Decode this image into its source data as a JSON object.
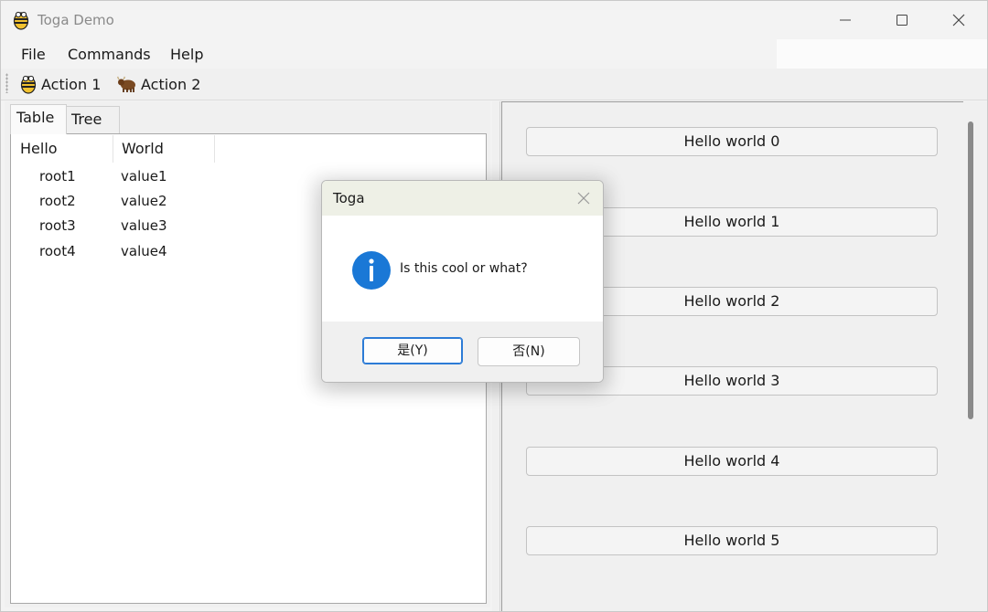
{
  "window": {
    "title": "Toga Demo"
  },
  "menu": {
    "items": [
      "File",
      "Commands",
      "Help"
    ]
  },
  "toolbar": {
    "action1_label": "Action 1",
    "action2_label": "Action 2"
  },
  "tabs": [
    {
      "label": "Table",
      "selected": true
    },
    {
      "label": "Tree",
      "selected": false
    }
  ],
  "table": {
    "columns": [
      "Hello",
      "World"
    ],
    "rows": [
      [
        "root1",
        "value1"
      ],
      [
        "root2",
        "value2"
      ],
      [
        "root3",
        "value3"
      ],
      [
        "root4",
        "value4"
      ]
    ]
  },
  "right_panel": {
    "buttons": [
      "Hello world 0",
      "Hello world 1",
      "Hello world 2",
      "Hello world 3",
      "Hello world 4",
      "Hello world 5"
    ]
  },
  "dialog": {
    "title": "Toga",
    "message": "Is this cool or what?",
    "yes_label": "是(Y)",
    "no_label": "否(N)",
    "icon": "info-icon"
  },
  "colors": {
    "accent": "#2c7bd6",
    "info_blue": "#1a78d6"
  }
}
